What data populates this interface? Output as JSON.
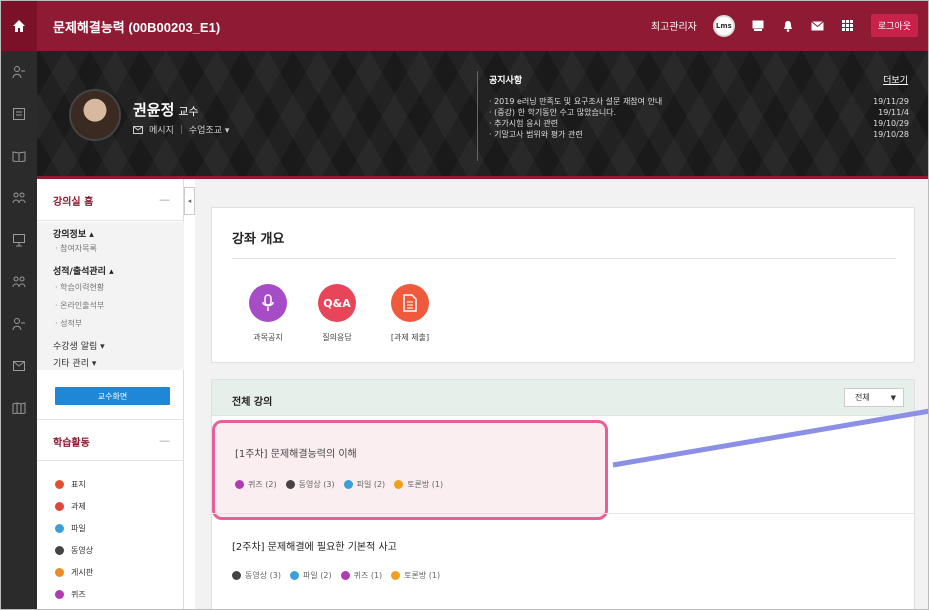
{
  "header": {
    "course_title": "문제해결능력 (00B00203_E1)",
    "admin_label": "최고관리자",
    "avatar_text": "Lms",
    "logout": "로그아웃"
  },
  "professor": {
    "name": "권윤정",
    "role": "교수",
    "message": "메시지",
    "class_adjust": "수업조교 ▾"
  },
  "notice": {
    "title": "공지사항",
    "more": "더보기",
    "items": [
      {
        "text": "· 2019 e러닝 만족도 및 요구조사 설문 재참여 안내",
        "date": "19/11/29"
      },
      {
        "text": "· (중강) 한 학기동안 수고 많았습니다.",
        "date": "19/11/4"
      },
      {
        "text": "· 추가시험 응시 관련",
        "date": "19/10/29"
      },
      {
        "text": "· 기말고사 범위와 평가 관련",
        "date": "19/10/28"
      }
    ]
  },
  "sidebar": {
    "home": "강의실 홈",
    "course_info": "강의정보 ▴",
    "participants": "· 참여자목록",
    "grades": "성적/출석관리 ▴",
    "history": "· 학습이력현황",
    "online_attend": "· 온라인출석부",
    "grade_book": "· 성적부",
    "alerts": "수강생 알림 ▾",
    "other": "기타 관리 ▾",
    "prof_button": "교수화면",
    "activities_title": "학습활동",
    "activities": [
      {
        "label": "표지",
        "color": "#e0522d"
      },
      {
        "label": "과제",
        "color": "#e0463a"
      },
      {
        "label": "파일",
        "color": "#3e9fd8"
      },
      {
        "label": "동영상",
        "color": "#444444"
      },
      {
        "label": "게시판",
        "color": "#f08a24"
      },
      {
        "label": "퀴즈",
        "color": "#b03ab0"
      }
    ]
  },
  "overview": {
    "title": "강좌 개요",
    "items": [
      {
        "label": "과목공지",
        "icon": "microphone-icon",
        "color": "#a64cc6",
        "glyph": ""
      },
      {
        "label": "질의응답",
        "icon": "qa-icon",
        "color": "#e8445a",
        "glyph": "Q&A"
      },
      {
        "label": "[과제 제출]",
        "icon": "document-icon",
        "color": "#ef5a3c",
        "glyph": ""
      }
    ]
  },
  "lectures": {
    "title": "전체 강의",
    "filter": "전체",
    "weeks": [
      {
        "title": "[1주차] 문제해결능력의 이해",
        "meta": [
          {
            "label": "퀴즈 (2)",
            "color": "#b03ab0"
          },
          {
            "label": "동영상 (3)",
            "color": "#444444"
          },
          {
            "label": "파일 (2)",
            "color": "#3e9fd8"
          },
          {
            "label": "토론방 (1)",
            "color": "#f0a020"
          }
        ]
      },
      {
        "title": "[2주차] 문제해결에 필요한 기본적 사고",
        "meta": [
          {
            "label": "동영상 (3)",
            "color": "#444444"
          },
          {
            "label": "파일 (2)",
            "color": "#3e9fd8"
          },
          {
            "label": "퀴즈 (1)",
            "color": "#b03ab0"
          },
          {
            "label": "토론방 (1)",
            "color": "#f0a020"
          }
        ]
      }
    ]
  }
}
